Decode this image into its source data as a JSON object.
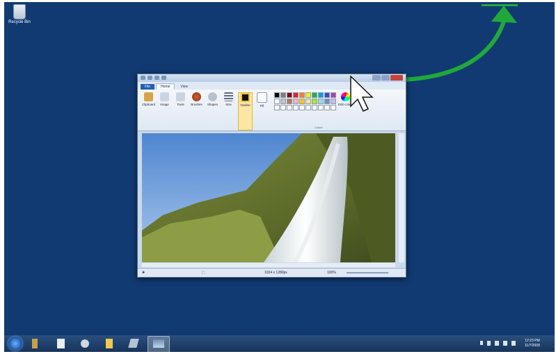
{
  "desktop": {
    "recycle_bin_label": "Recycle Bin"
  },
  "paint": {
    "tabs": [
      "File",
      "Home",
      "View"
    ],
    "tools": [
      {
        "label": "Clipboard",
        "icon": "clipboard-icon"
      },
      {
        "label": "Image",
        "icon": "image-icon"
      },
      {
        "label": "Tools",
        "icon": "tools-icon"
      },
      {
        "label": "Brushes",
        "icon": "brush-icon"
      },
      {
        "label": "Shapes",
        "icon": "shapes-icon"
      },
      {
        "label": "Size",
        "icon": "size-icon"
      },
      {
        "label": "Outline",
        "icon": "outline-icon"
      },
      {
        "label": "Fill",
        "icon": "fill-icon"
      }
    ],
    "colors_group_label": "Colors",
    "edit_colors_label": "Edit colors",
    "palette": [
      "#000000",
      "#7f7f7f",
      "#880015",
      "#ed1c24",
      "#ff7f27",
      "#fff200",
      "#22b14c",
      "#00a2e8",
      "#3f48cc",
      "#a349a4",
      "#ffffff",
      "#c3c3c3",
      "#b97a57",
      "#ffaec9",
      "#ffc90e",
      "#efe4b0",
      "#b5e61d",
      "#99d9ea",
      "#7092be",
      "#c8bfe7",
      "#ffffff",
      "#ffffff",
      "#ffffff",
      "#ffffff",
      "#ffffff",
      "#ffffff",
      "#ffffff",
      "#ffffff",
      "#ffffff",
      "#ffffff"
    ],
    "status": {
      "image_size": "1024 x 1280px",
      "zoom": "100%"
    }
  },
  "taskbar": {
    "clock_time": "12:23 PM",
    "clock_date": "11/7/2008"
  },
  "accent": {
    "snap_green": "#21a83a",
    "desktop_blue": "#113a72"
  }
}
